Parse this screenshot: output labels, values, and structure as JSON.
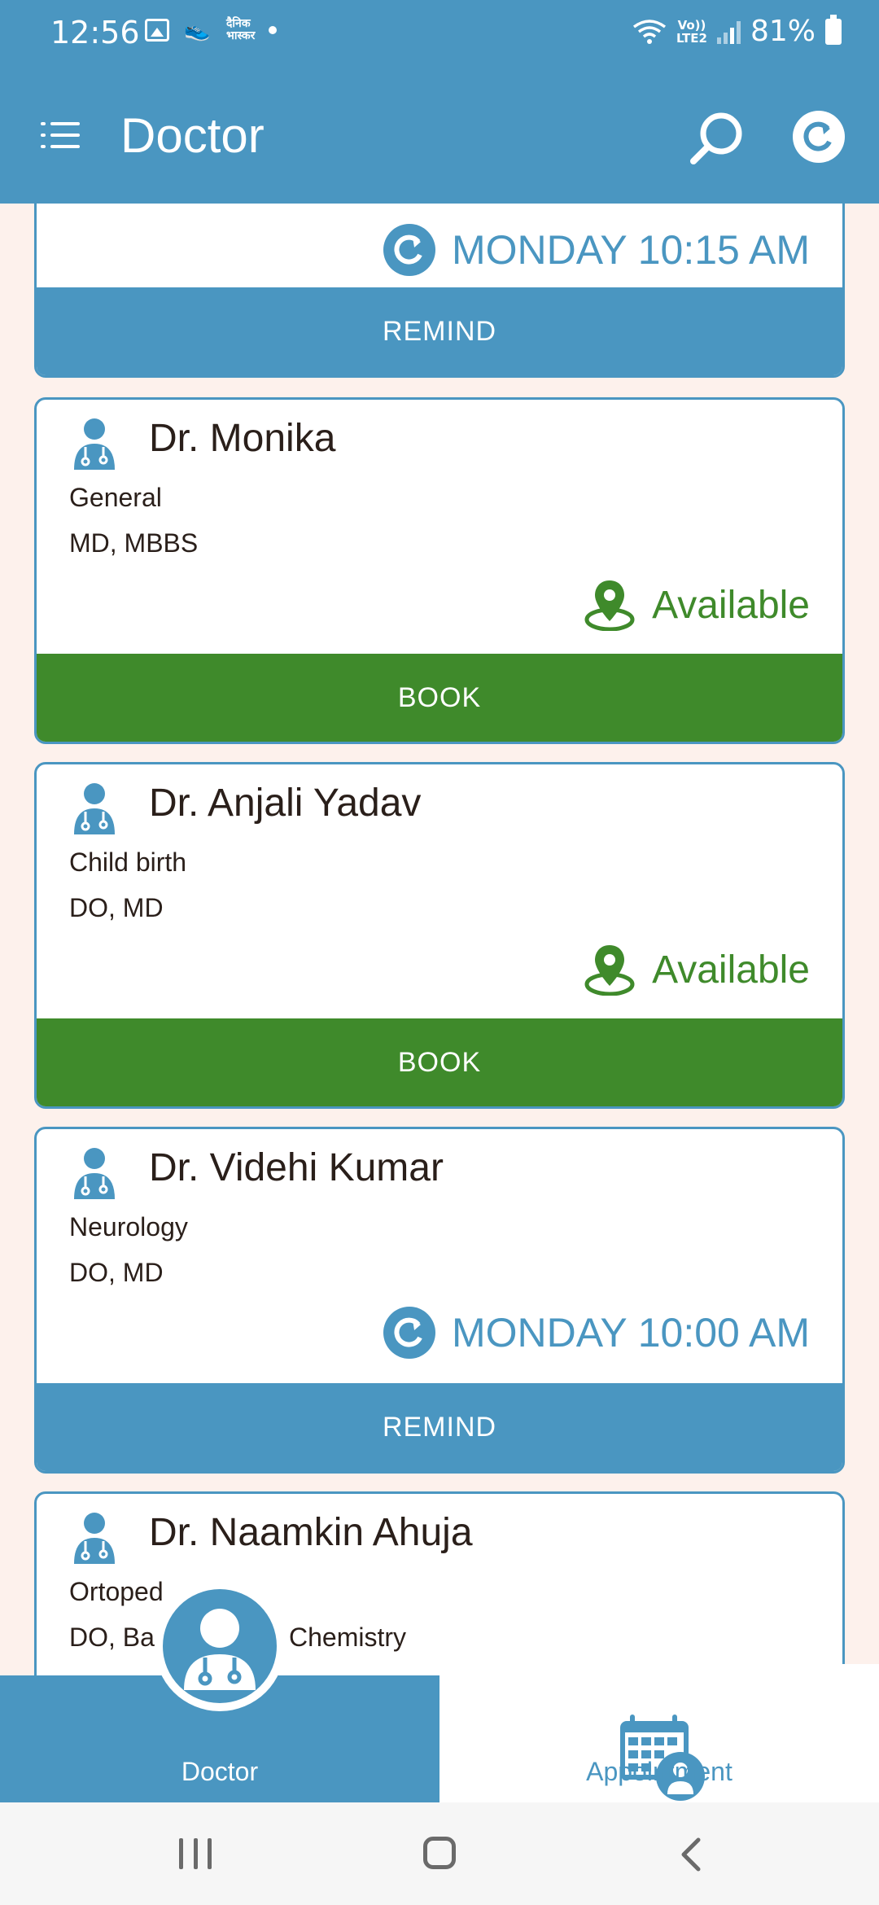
{
  "status_bar": {
    "time": "12:56",
    "app2_text": "दैनिक भास्कर",
    "lte_line1": "Vo))",
    "lte_line2": "LTE2",
    "battery": "81%"
  },
  "app_bar": {
    "title": "Doctor",
    "icons": [
      "menu-icon",
      "search-icon",
      "refresh-icon"
    ]
  },
  "cards": [
    {
      "status_text": "MONDAY 10:15 AM",
      "status_icon": "refresh-icon",
      "button_label": "REMIND"
    },
    {
      "name": "Dr. Monika",
      "specialty": "General",
      "degree": "MD, MBBS",
      "status_text": "Available",
      "status_icon": "location-pin-icon",
      "button_label": "BOOK"
    },
    {
      "name": "Dr. Anjali Yadav",
      "specialty": "Child birth",
      "degree": "DO, MD",
      "status_text": "Available",
      "status_icon": "location-pin-icon",
      "button_label": "BOOK"
    },
    {
      "name": "Dr. Videhi Kumar",
      "specialty": "Neurology",
      "degree": "DO, MD",
      "status_text": "MONDAY 10:00 AM",
      "status_icon": "refresh-icon",
      "button_label": "REMIND"
    },
    {
      "name": "Dr. Naamkin Ahuja",
      "specialty": "Ortoped",
      "degree_left": "DO, Ba",
      "degree_right": "Chemistry"
    }
  ],
  "bottom_nav": {
    "doctor_label": "Doctor",
    "appointment_label": "Appointment"
  },
  "colors": {
    "primary": "#4a96c1",
    "book_green": "#3f8a2b",
    "background": "#fdf1ec"
  }
}
